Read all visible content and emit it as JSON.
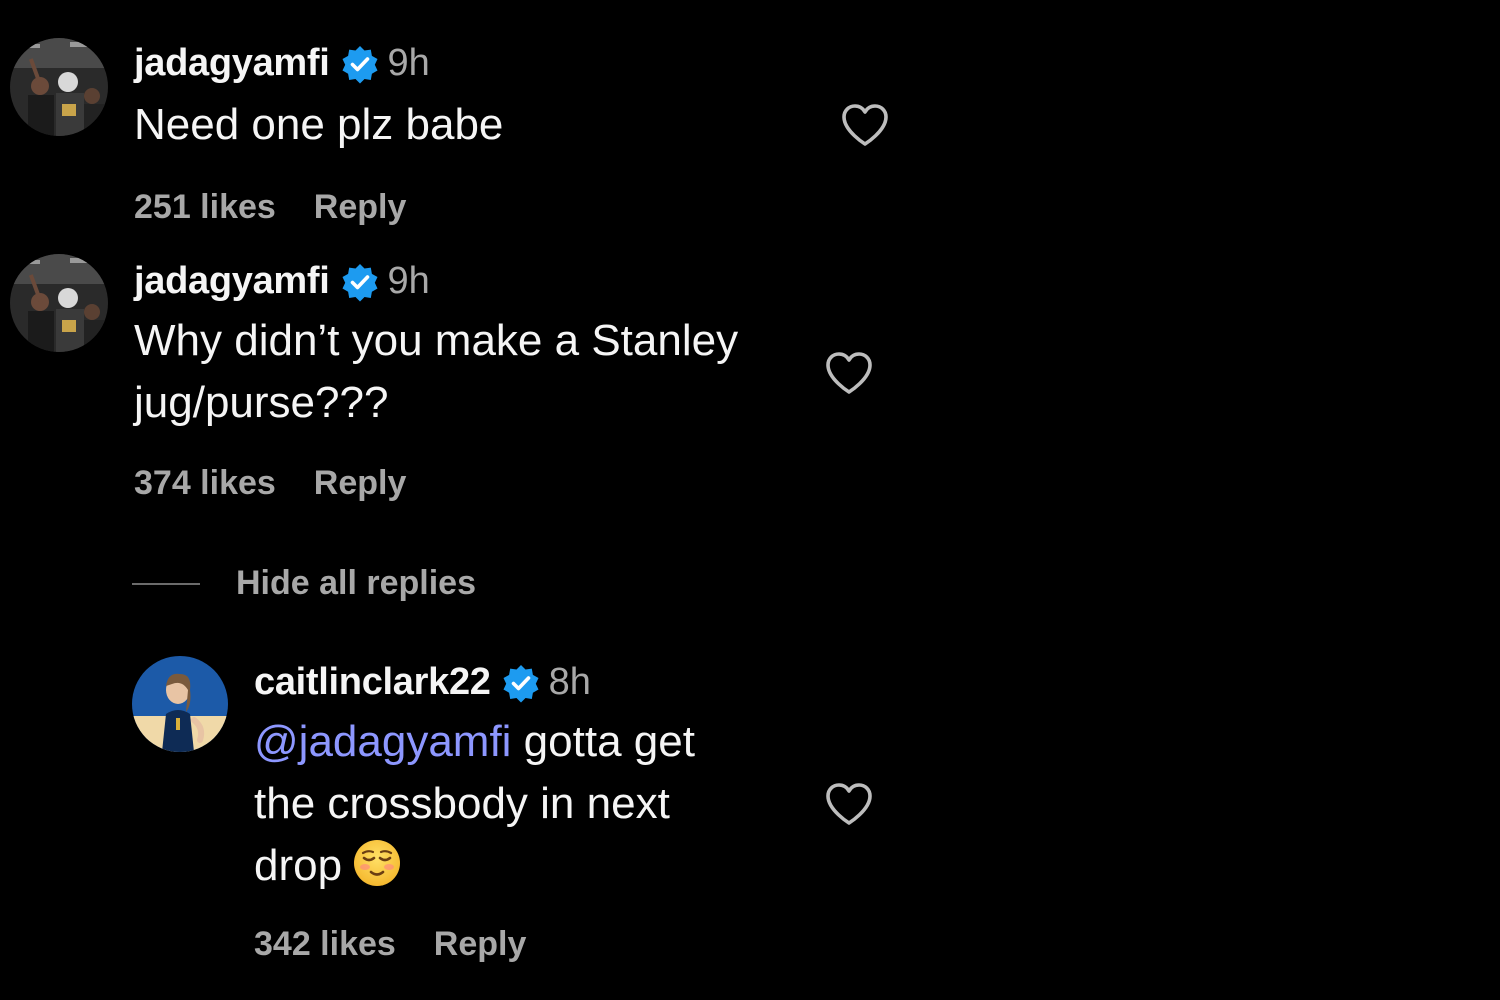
{
  "comments": [
    {
      "username": "jadagyamfi",
      "time": "9h",
      "lines": [
        "Need one plz babe"
      ],
      "likes": "251 likes",
      "reply_label": "Reply"
    },
    {
      "username": "jadagyamfi",
      "time": "9h",
      "lines": [
        "Why didn’t you make a Stanley",
        "jug/purse???"
      ],
      "likes": "374 likes",
      "reply_label": "Reply"
    }
  ],
  "hide_replies_label": "Hide all replies",
  "reply": {
    "username": "caitlinclark22",
    "time": "8h",
    "mention": "@jadagyamfi",
    "lines": [
      " gotta get",
      "the crossbody in next",
      "drop"
    ],
    "emoji": "relieved-face-emoji",
    "likes": "342 likes",
    "reply_label": "Reply"
  },
  "icons": {
    "verified": "verified-badge-icon",
    "like": "heart-outline-icon"
  },
  "colors": {
    "background": "#000000",
    "text": "#f5f5f5",
    "secondary": "#a8a8a8",
    "verified": "#1d9bf0",
    "mention": "#8d97ff"
  }
}
